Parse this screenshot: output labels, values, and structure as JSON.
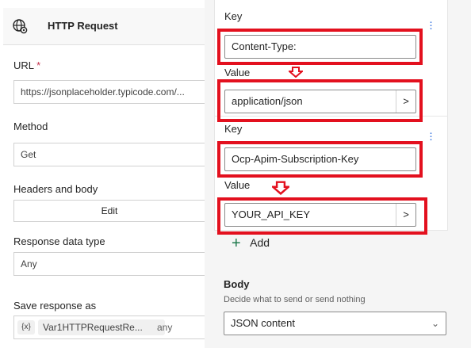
{
  "action": {
    "title": "HTTP Request",
    "icon": "globe-settings-icon"
  },
  "form": {
    "url_label": "URL",
    "required_mark": "*",
    "url_value": "https://jsonplaceholder.typicode.com/...",
    "method_label": "Method",
    "method_value": "Get",
    "headers_label": "Headers and body",
    "edit_label": "Edit",
    "response_type_label": "Response data type",
    "response_type_value": "Any",
    "save_label": "Save response as",
    "var_icon_text": "{x}",
    "var_name": "Var1HTTPRequestRe...",
    "var_type": "any"
  },
  "headers": [
    {
      "key_label": "Key",
      "key_value": "Content-Type:",
      "value_label": "Value",
      "value": "application/json"
    },
    {
      "key_label": "Key",
      "key_value": "Ocp-Apim-Subscription-Key",
      "value_label": "Value",
      "value": "YOUR_API_KEY"
    }
  ],
  "add_label": "Add",
  "body": {
    "label": "Body",
    "description": "Decide what to send or send nothing",
    "value": "JSON content"
  },
  "colors": {
    "highlight": "#e3101e",
    "accent": "#2f6fde"
  }
}
